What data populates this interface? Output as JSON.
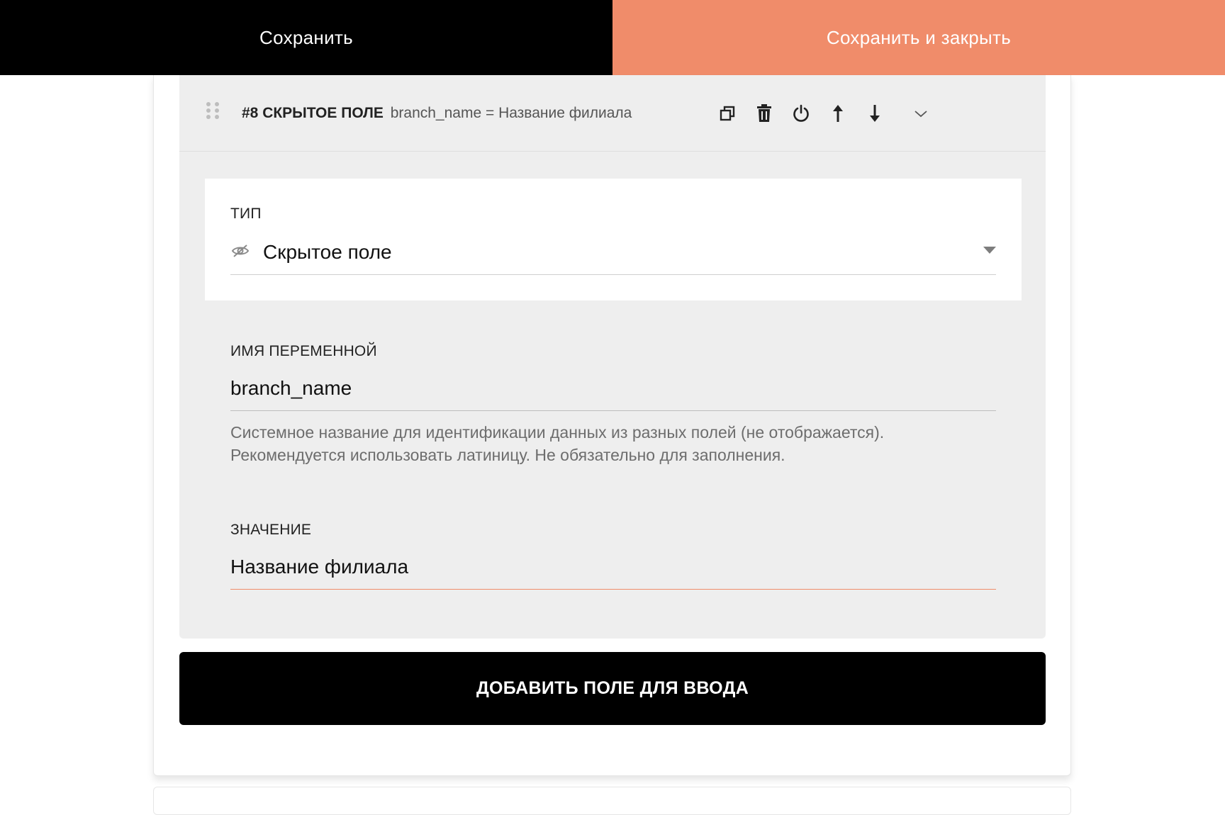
{
  "topbar": {
    "save_label": "Сохранить",
    "save_close_label": "Сохранить и закрыть",
    "accent_color": "#f08c6a"
  },
  "field": {
    "number": "#8 СКРЫТОЕ ПОЛЕ",
    "summary": "branch_name = Название филиала",
    "actions": [
      "copy-icon",
      "trash-icon",
      "power-icon",
      "arrow-up-icon",
      "arrow-down-icon",
      "chevron-down-icon"
    ],
    "type": {
      "label": "ТИП",
      "value": "Скрытое поле",
      "icon": "eye-slash-icon"
    },
    "variable": {
      "label": "ИМЯ ПЕРЕМЕННОЙ",
      "value": "branch_name",
      "hint_line1": "Системное название для идентификации данных из разных полей (не отображается).",
      "hint_line2": "Рекомендуется использовать латиницу. Не обязательно для заполнения."
    },
    "value_field": {
      "label": "ЗНАЧЕНИЕ",
      "value": "Название филиала"
    }
  },
  "add_button_label": "ДОБАВИТЬ ПОЛЕ ДЛЯ ВВОДА"
}
